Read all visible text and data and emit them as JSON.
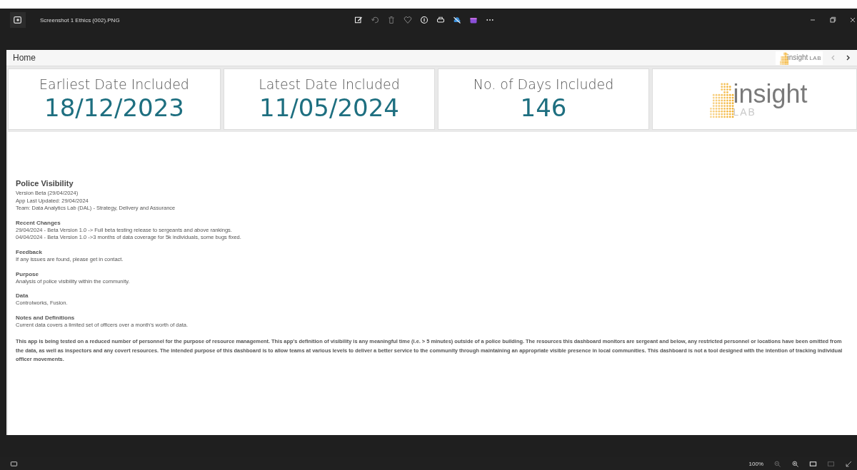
{
  "window": {
    "title": "Screenshot 1 Ethics (002).PNG"
  },
  "header": {
    "title": "Home",
    "logo": {
      "word": "insight",
      "sub": "LAB"
    }
  },
  "cards": [
    {
      "kind": "stat",
      "label": "Earliest Date Included",
      "value": "18/12/2023"
    },
    {
      "kind": "stat",
      "label": "Latest Date Included",
      "value": "11/05/2024"
    },
    {
      "kind": "stat",
      "label": "No. of Days Included",
      "value": "146"
    },
    {
      "kind": "logo",
      "word": "insight",
      "sub": "LAB"
    }
  ],
  "app": {
    "title": "Police Visibility",
    "lines": [
      "Version Beta (29/04/2024)",
      "App Last Updated: 29/04/2024",
      "Team: Data Analytics Lab (DAL) - Strategy, Delivery and Assurance"
    ]
  },
  "sections": [
    {
      "heading": "Recent Changes",
      "lines": [
        "29/04/2024 - Beta Version 1.0 -> Full beta testing release to sergeants and above rankings.",
        "04/04/2024 - Beta Version 1.0 ->3 months of data coverage for 5k individuals, some bugs fixed."
      ]
    },
    {
      "heading": "Feedback",
      "lines": [
        "If any issues are found, please get in contact."
      ]
    },
    {
      "heading": "Purpose",
      "lines": [
        "Analysis of police visibility within the community."
      ]
    },
    {
      "heading": "Data",
      "lines": [
        "Controlworks, Fusion."
      ]
    },
    {
      "heading": "Notes and Definitions",
      "lines": [
        "Current data covers a limited set of officers over a month's worth of data."
      ]
    }
  ],
  "disclaimer": "This app is being tested on a reduced number of personnel for the purpose of resource management. This app's definition of visibility is any meaningful time (i.e. > 5 minutes) outside of a police building. The resources this dashboard monitors are sergeant and below, any restricted personnel or locations have been omitted from the data, as well as inspectors and any covert resources. The intended purpose of this dashboard is to allow teams at various levels to deliver a better service to the community through maintaining an appropriate visible presence in local communities. This dashboard is not a tool designed with the intention of tracking individual officer movements.",
  "status_bar": {
    "zoom": "100%"
  }
}
